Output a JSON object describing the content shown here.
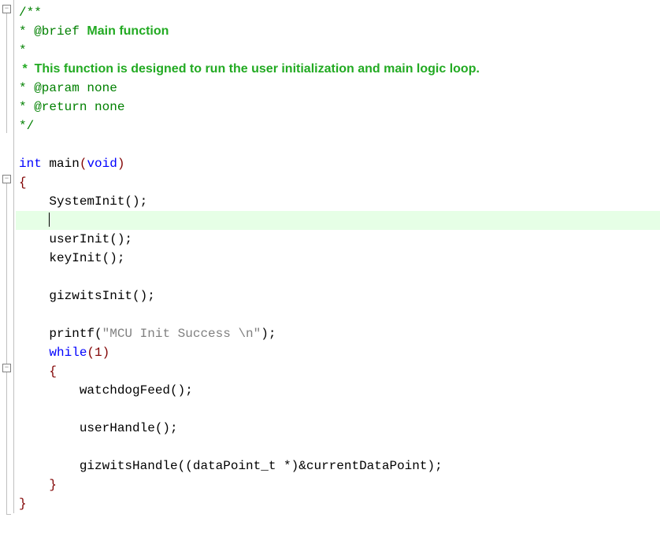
{
  "comment": {
    "open": "/**",
    "brief_tag": "* @brief ",
    "brief_text": "Main function",
    "star": "*",
    "desc_prefix": " *  ",
    "desc_text": "This function is designed to run the user initialization and main logic loop.",
    "param": "* @param none",
    "return": "* @return none",
    "close": "*/"
  },
  "code": {
    "int": "int",
    "main": " main",
    "paren_open": "(",
    "void": "void",
    "paren_close": ")",
    "brace_open": "{",
    "system_init": "    SystemInit();",
    "blank_indent": "    ",
    "user_init": "    userInit();",
    "key_init": "    keyInit();",
    "gizwits_init": "    gizwitsInit();",
    "printf_pre": "    printf(",
    "printf_str": "\"MCU Init Success \\n\"",
    "printf_end": ");",
    "while": "    while",
    "while_cond": "(1)",
    "inner_brace_open": "    {",
    "watchdog": "        watchdogFeed();",
    "user_handle": "        userHandle();",
    "gizwits_handle": "        gizwitsHandle((dataPoint_t *)&currentDataPoint);",
    "inner_brace_close": "    }",
    "brace_close": "}"
  }
}
